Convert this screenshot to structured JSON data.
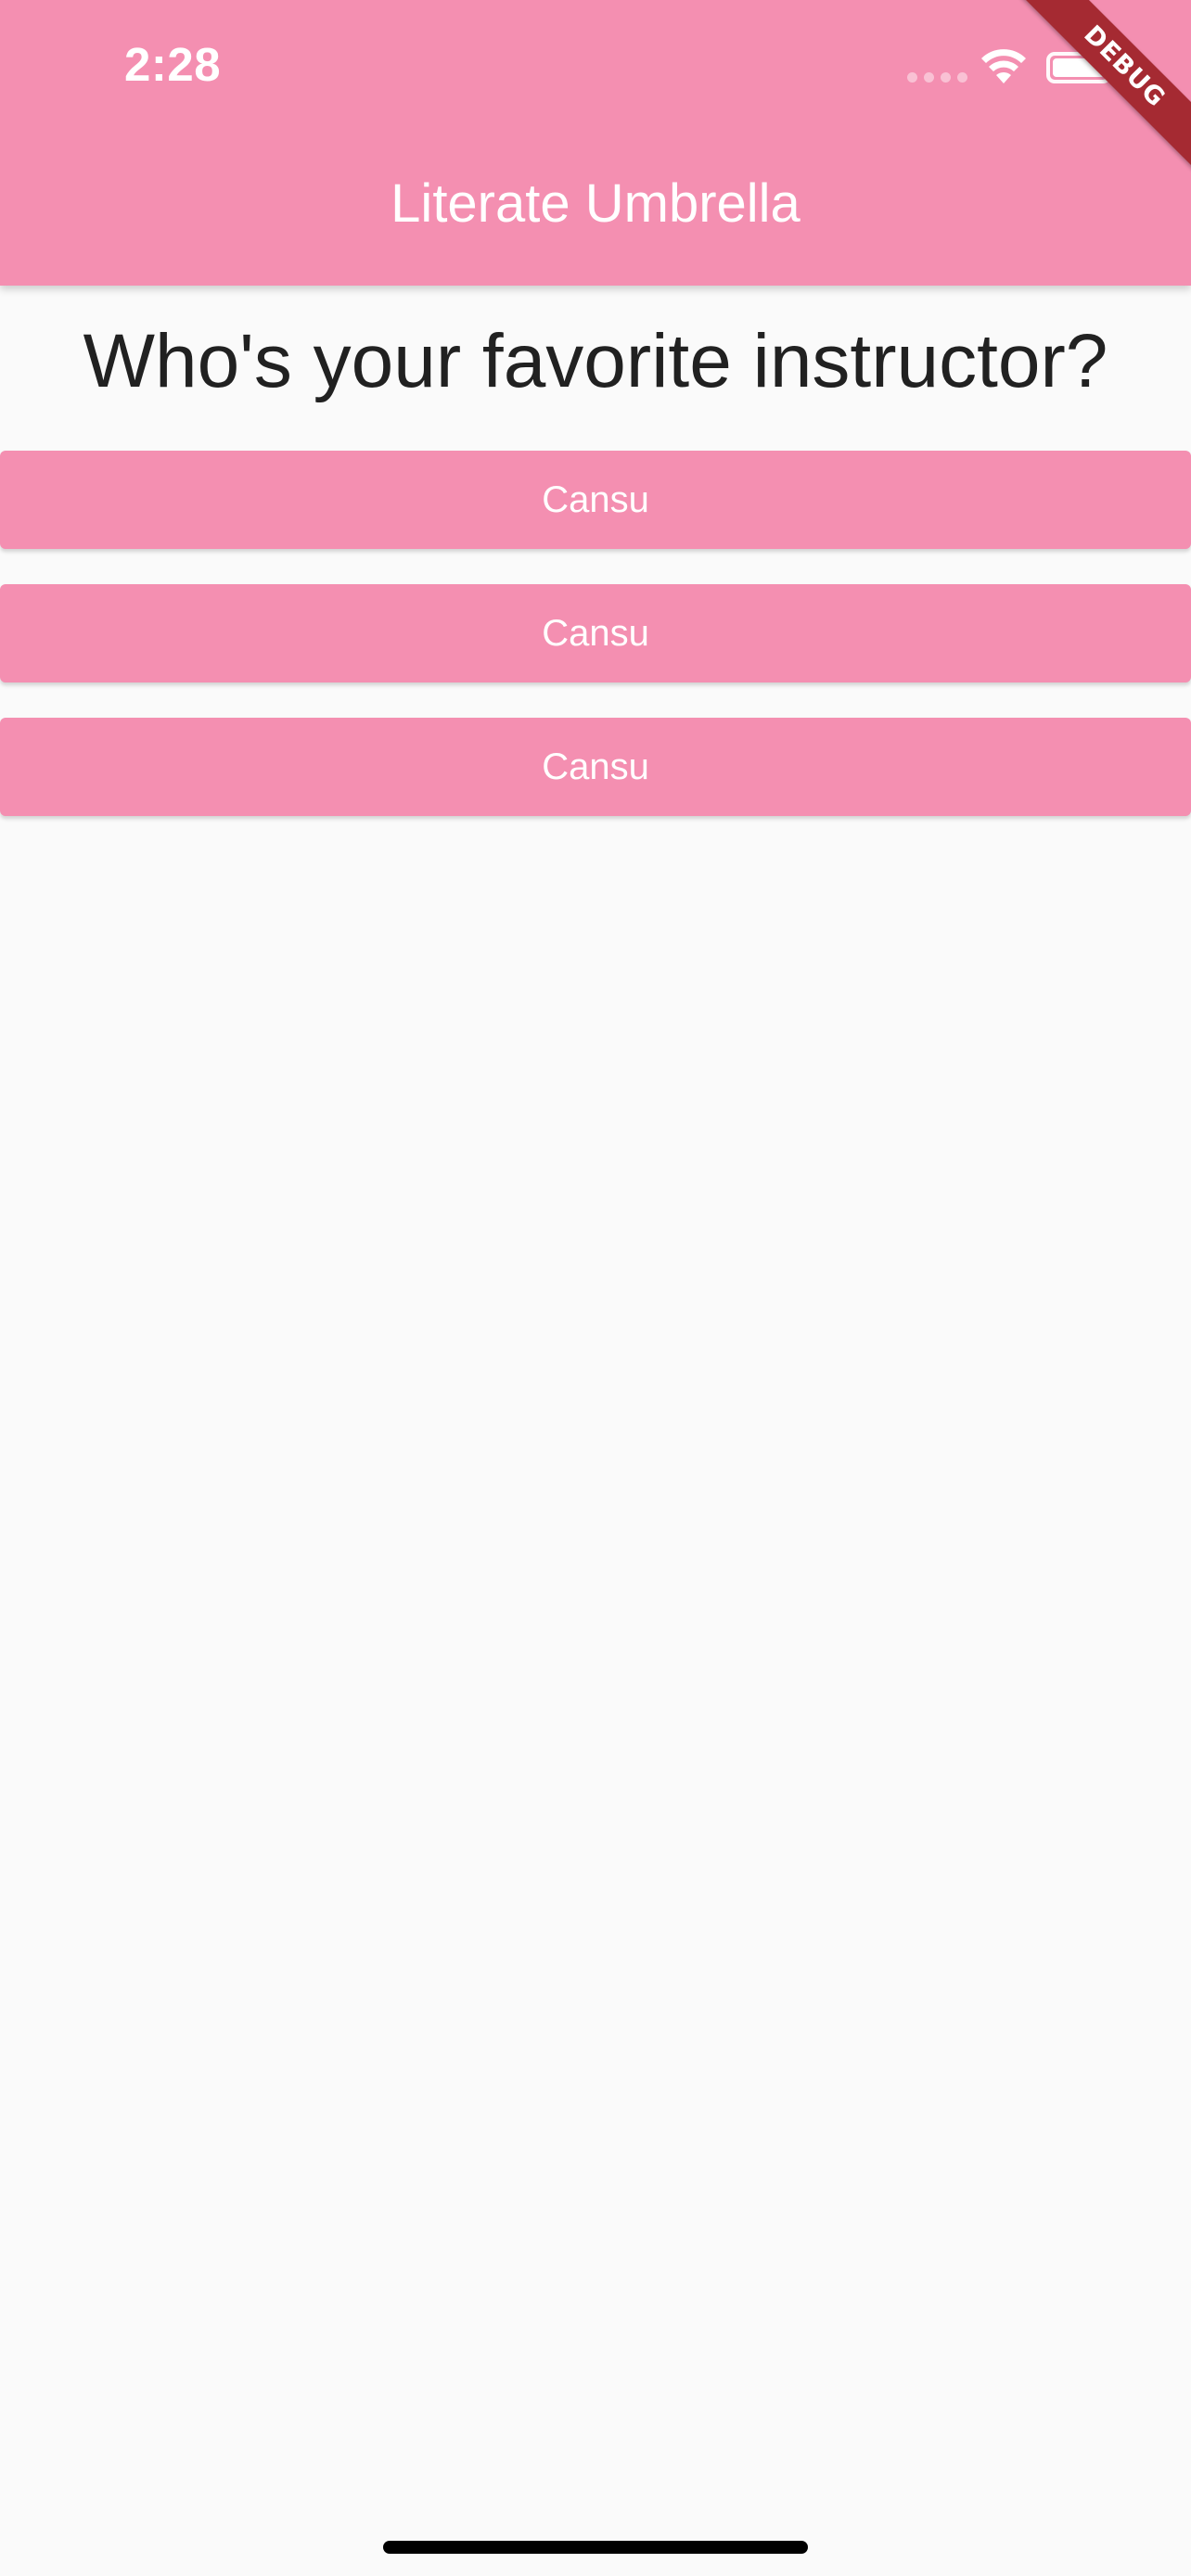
{
  "status_bar": {
    "time": "2:28"
  },
  "app_bar": {
    "title": "Literate Umbrella",
    "color": "#f48fb1"
  },
  "debug_banner": "DEBUG",
  "question": "Who's your favorite instructor?",
  "answers": [
    {
      "label": "Cansu"
    },
    {
      "label": "Cansu"
    },
    {
      "label": "Cansu"
    }
  ],
  "icons": {
    "signal": "cellular-signal-icon",
    "wifi": "wifi-icon",
    "battery": "battery-icon"
  }
}
